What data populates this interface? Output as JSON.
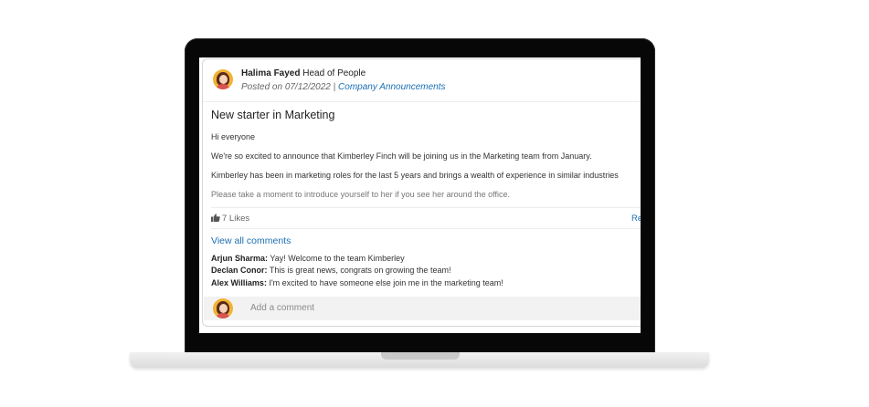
{
  "post": {
    "author_name": "Halima Fayed",
    "author_role": "Head of People",
    "posted_prefix": "Posted on 07/12/2022 |",
    "category": "Company Announcements",
    "title": "New starter in Marketing",
    "paragraphs": [
      "Hi everyone",
      "We're so excited to announce that Kimberley Finch will be joining us in the Marketing team from January.",
      "Kimberley has been in marketing roles for the last 5 years and brings a wealth of experience in similar industries",
      "Please take a moment to introduce yourself to her if you see her around the office."
    ],
    "likes_label": "7 Likes",
    "reply_label": "Re"
  },
  "comments": {
    "view_all_label": "View all comments",
    "items": [
      {
        "author": "Arjun Sharma:",
        "text": " Yay! Welcome to the team Kimberley"
      },
      {
        "author": "Declan Conor:",
        "text": " This is great news, congrats on growing the team!"
      },
      {
        "author": "Alex Williams:",
        "text": " I'm excited to have someone else join me in the marketing team!"
      }
    ],
    "add_placeholder": "Add a comment"
  },
  "icons": {
    "avatar": "user-avatar-icon",
    "likes": "thumbs-up-icon"
  }
}
